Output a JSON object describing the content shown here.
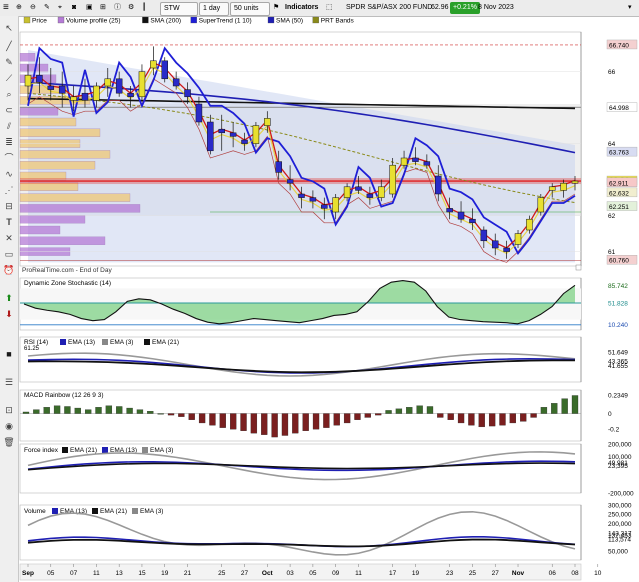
{
  "toolbar": {
    "menu_glyph": "≡",
    "ticker": "STW",
    "interval": "1 day",
    "units": "50 units",
    "indicators_label": "Indicators",
    "title": "SPDR S&P/ASX 200 FUND",
    "last_price": "62.96",
    "change": "+0.21%",
    "date": "8 Nov 2023"
  },
  "legend": {
    "price": "Price",
    "volume_profile": "Volume profile (25)",
    "sma200": "SMA (200)",
    "supertrend": "SuperTrend (1 10)",
    "sma50": "SMA (50)",
    "prt_bands": "PRT Bands"
  },
  "watermark": "ProRealTime.com - End of Day",
  "colors": {
    "up": "#1a1a1a",
    "down": "#1a1a1a",
    "supertrend_up": "#1f1fd6",
    "sma50": "#1f1fb3",
    "sma200": "#111111",
    "prt_band": "#8a8a1a",
    "volume_profile": "#b57bd6",
    "volume_profile_alt": "#f0c878",
    "macd_up": "#3a6b2a",
    "macd_down": "#7a1f1f",
    "stoch_fill_up": "#2fb83a",
    "stoch_fill_down": "#d88080"
  },
  "x_labels": [
    "Sep",
    "05",
    "07",
    "11",
    "13",
    "15",
    "19",
    "21",
    "25",
    "27",
    "Oct",
    "03",
    "05",
    "09",
    "11",
    "17",
    "19",
    "23",
    "25",
    "27",
    "Nov",
    "06",
    "08",
    "10"
  ],
  "chart_data": [
    {
      "name": "price",
      "type": "candlestick",
      "ylim": [
        60.6,
        67.1
      ],
      "y_ticks": [
        61,
        62,
        63,
        64,
        65,
        66
      ],
      "value_labels": [
        "66.740",
        "64.998",
        "63.763",
        "62.96",
        "62.911",
        "62.632",
        "62.251",
        "60.760"
      ],
      "horizontal_levels": {
        "sma200": 64.998,
        "red_zone": 62.96,
        "upper_red": 66.74,
        "lower_red": 60.76
      },
      "candles": [
        {
          "x": "Aug31",
          "o": 65.6,
          "h": 66.2,
          "l": 65.2,
          "c": 65.9
        },
        {
          "x": "Sep01",
          "o": 65.9,
          "h": 66.4,
          "l": 65.4,
          "c": 65.7
        },
        {
          "x": "Sep04",
          "o": 65.6,
          "h": 66.1,
          "l": 65.2,
          "c": 65.5
        },
        {
          "x": "Sep05",
          "o": 65.6,
          "h": 66.0,
          "l": 65.0,
          "c": 65.4
        },
        {
          "x": "Sep06",
          "o": 65.2,
          "h": 65.6,
          "l": 64.9,
          "c": 65.3
        },
        {
          "x": "Sep07",
          "o": 65.4,
          "h": 65.8,
          "l": 65.0,
          "c": 65.2
        },
        {
          "x": "Sep08",
          "o": 65.2,
          "h": 65.7,
          "l": 65.0,
          "c": 65.6
        },
        {
          "x": "Sep11",
          "o": 65.6,
          "h": 66.1,
          "l": 65.3,
          "c": 65.8
        },
        {
          "x": "Sep12",
          "o": 65.8,
          "h": 66.0,
          "l": 65.3,
          "c": 65.4
        },
        {
          "x": "Sep13",
          "o": 65.4,
          "h": 65.6,
          "l": 65.0,
          "c": 65.3
        },
        {
          "x": "Sep14",
          "o": 65.3,
          "h": 66.2,
          "l": 65.2,
          "c": 66.0
        },
        {
          "x": "Sep15",
          "o": 66.1,
          "h": 66.7,
          "l": 65.9,
          "c": 66.3
        },
        {
          "x": "Sep18",
          "o": 66.3,
          "h": 66.4,
          "l": 65.7,
          "c": 65.8
        },
        {
          "x": "Sep19",
          "o": 65.8,
          "h": 66.0,
          "l": 65.5,
          "c": 65.6
        },
        {
          "x": "Sep20",
          "o": 65.5,
          "h": 65.7,
          "l": 65.1,
          "c": 65.3
        },
        {
          "x": "Sep21",
          "o": 65.1,
          "h": 65.3,
          "l": 64.5,
          "c": 64.6
        },
        {
          "x": "Sep22",
          "o": 64.6,
          "h": 64.8,
          "l": 63.7,
          "c": 63.8
        },
        {
          "x": "Sep25",
          "o": 64.4,
          "h": 64.8,
          "l": 63.8,
          "c": 64.3
        },
        {
          "x": "Sep26",
          "o": 64.3,
          "h": 64.6,
          "l": 63.9,
          "c": 64.2
        },
        {
          "x": "Sep27",
          "o": 64.1,
          "h": 64.3,
          "l": 63.8,
          "c": 64.0
        },
        {
          "x": "Sep28",
          "o": 64.0,
          "h": 64.6,
          "l": 63.9,
          "c": 64.5
        },
        {
          "x": "Sep29",
          "o": 64.5,
          "h": 64.9,
          "l": 64.3,
          "c": 64.7
        },
        {
          "x": "Oct02",
          "o": 63.5,
          "h": 63.8,
          "l": 63.0,
          "c": 63.2
        },
        {
          "x": "Oct03",
          "o": 63.0,
          "h": 63.4,
          "l": 62.7,
          "c": 62.9
        },
        {
          "x": "Oct04",
          "o": 62.6,
          "h": 62.8,
          "l": 62.2,
          "c": 62.5
        },
        {
          "x": "Oct05",
          "o": 62.5,
          "h": 62.7,
          "l": 62.2,
          "c": 62.4
        },
        {
          "x": "Oct06",
          "o": 62.3,
          "h": 62.5,
          "l": 61.9,
          "c": 62.2
        },
        {
          "x": "Oct09",
          "o": 62.1,
          "h": 62.6,
          "l": 61.9,
          "c": 62.5
        },
        {
          "x": "Oct10",
          "o": 62.5,
          "h": 62.9,
          "l": 62.4,
          "c": 62.8
        },
        {
          "x": "Oct11",
          "o": 62.8,
          "h": 63.1,
          "l": 62.6,
          "c": 62.7
        },
        {
          "x": "Oct12",
          "o": 62.6,
          "h": 62.8,
          "l": 62.3,
          "c": 62.5
        },
        {
          "x": "Oct13",
          "o": 62.5,
          "h": 63.0,
          "l": 62.4,
          "c": 62.8
        },
        {
          "x": "Oct16",
          "o": 62.6,
          "h": 63.6,
          "l": 62.5,
          "c": 63.4
        },
        {
          "x": "Oct17",
          "o": 63.4,
          "h": 63.8,
          "l": 63.3,
          "c": 63.6
        },
        {
          "x": "Oct18",
          "o": 63.6,
          "h": 63.9,
          "l": 63.4,
          "c": 63.5
        },
        {
          "x": "Oct19",
          "o": 63.5,
          "h": 63.7,
          "l": 63.3,
          "c": 63.4
        },
        {
          "x": "Oct20",
          "o": 63.1,
          "h": 63.4,
          "l": 62.4,
          "c": 62.6
        },
        {
          "x": "Oct23",
          "o": 62.2,
          "h": 62.5,
          "l": 61.9,
          "c": 62.1
        },
        {
          "x": "Oct24",
          "o": 62.1,
          "h": 62.4,
          "l": 61.8,
          "c": 61.9
        },
        {
          "x": "Oct25",
          "o": 61.9,
          "h": 62.2,
          "l": 61.6,
          "c": 61.8
        },
        {
          "x": "Oct26",
          "o": 61.6,
          "h": 61.7,
          "l": 61.1,
          "c": 61.3
        },
        {
          "x": "Oct27",
          "o": 61.3,
          "h": 61.5,
          "l": 60.9,
          "c": 61.1
        },
        {
          "x": "Oct30",
          "o": 61.1,
          "h": 61.3,
          "l": 60.8,
          "c": 61.0
        },
        {
          "x": "Oct31",
          "o": 61.2,
          "h": 61.6,
          "l": 61.1,
          "c": 61.5
        },
        {
          "x": "Nov01",
          "o": 61.6,
          "h": 62.0,
          "l": 61.5,
          "c": 61.9
        },
        {
          "x": "Nov02",
          "o": 62.1,
          "h": 62.6,
          "l": 62.0,
          "c": 62.5
        },
        {
          "x": "Nov06",
          "o": 62.7,
          "h": 62.9,
          "l": 62.5,
          "c": 62.8
        },
        {
          "x": "Nov07",
          "o": 62.7,
          "h": 63.0,
          "l": 62.5,
          "c": 62.9
        },
        {
          "x": "Nov08",
          "o": 62.9,
          "h": 63.1,
          "l": 62.7,
          "c": 62.96
        }
      ]
    },
    {
      "name": "stochastic",
      "type": "line",
      "title": "Dynamic Zone Stochastic (14)",
      "ylim": [
        0,
        100
      ],
      "value_labels": [
        "85.742",
        "51.828",
        "10.240"
      ],
      "series": [
        {
          "name": "stochastic",
          "values": [
            50,
            42,
            38,
            35,
            30,
            22,
            18,
            20,
            35,
            55,
            60,
            58,
            50,
            40,
            32,
            22,
            15,
            12,
            14,
            18,
            22,
            20,
            18,
            16,
            14,
            18,
            22,
            28,
            30,
            35,
            55,
            80,
            92,
            95,
            92,
            75,
            45,
            25,
            20,
            18,
            16,
            15,
            14,
            12,
            18,
            30,
            45,
            70,
            86
          ]
        }
      ]
    },
    {
      "name": "rsi",
      "type": "line",
      "title": "RSI (14)",
      "ylim": [
        20,
        80
      ],
      "value_labels": [
        "51.649",
        "43.365",
        "41.655"
      ],
      "legend": [
        "EMA (13)",
        "EMA (3)",
        "EMA (21)"
      ]
    },
    {
      "name": "macd",
      "type": "bar",
      "title": "MACD Rainbow (12 26 9 3)",
      "ylim": [
        -0.35,
        0.3
      ],
      "value_labels": [
        "0.2349",
        "0",
        "-0.2"
      ],
      "values": [
        0.02,
        0.05,
        0.08,
        0.1,
        0.09,
        0.07,
        0.05,
        0.08,
        0.1,
        0.09,
        0.07,
        0.05,
        0.03,
        0.0,
        -0.02,
        -0.04,
        -0.08,
        -0.12,
        -0.15,
        -0.18,
        -0.2,
        -0.22,
        -0.25,
        -0.27,
        -0.3,
        -0.28,
        -0.25,
        -0.22,
        -0.2,
        -0.18,
        -0.15,
        -0.12,
        -0.08,
        -0.05,
        -0.02,
        0.04,
        0.06,
        0.08,
        0.1,
        0.09,
        -0.05,
        -0.08,
        -0.12,
        -0.15,
        -0.17,
        -0.16,
        -0.15,
        -0.12,
        -0.1,
        -0.05,
        0.08,
        0.13,
        0.19,
        0.23
      ]
    },
    {
      "name": "force_index",
      "type": "line",
      "title": "Force index",
      "ylim": [
        -200000,
        200000
      ],
      "value_labels": [
        "200,000",
        "100,000",
        "49,981",
        "23,395",
        "-200,000"
      ],
      "legend": [
        "EMA (21)",
        "EMA (13)",
        "EMA (3)"
      ]
    },
    {
      "name": "volume",
      "type": "line",
      "title": "Volume",
      "ylim": [
        0,
        300000
      ],
      "value_labels": [
        "300,000",
        "250,000",
        "200,000",
        "143,317",
        "137,453",
        "113,574",
        "50,000"
      ],
      "legend": [
        "EMA (13)",
        "EMA (21)",
        "EMA (3)"
      ]
    }
  ]
}
